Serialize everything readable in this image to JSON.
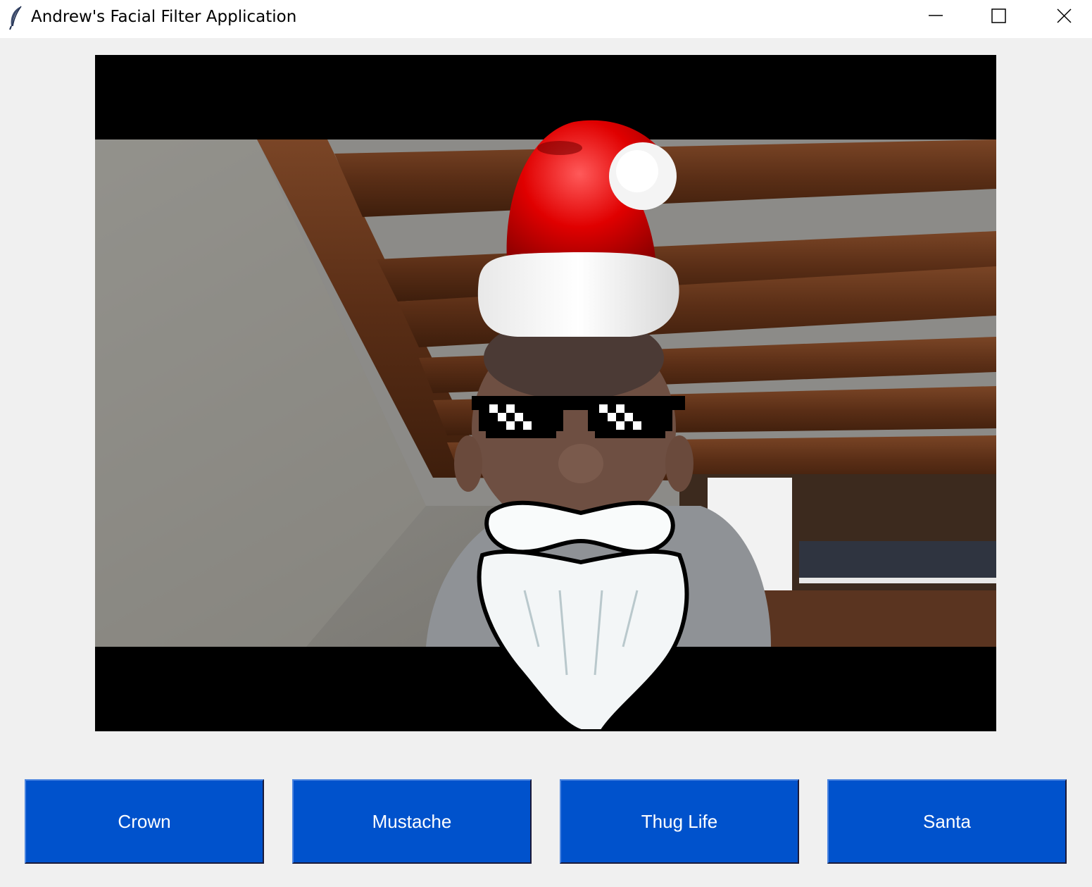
{
  "window": {
    "title": "Andrew's Facial Filter Application",
    "icon": "feather-icon",
    "controls": [
      "minimize-icon",
      "maximize-icon",
      "close-icon"
    ]
  },
  "video": {
    "active_overlays": [
      "santa-hat",
      "thug-life-glasses",
      "santa-beard"
    ]
  },
  "buttons": {
    "crown": "Crown",
    "mustache": "Mustache",
    "thug_life": "Thug Life",
    "santa": "Santa"
  },
  "colors": {
    "button_bg": "#0052cc",
    "button_text": "#ffffff",
    "window_bg": "#f0f0f0"
  }
}
